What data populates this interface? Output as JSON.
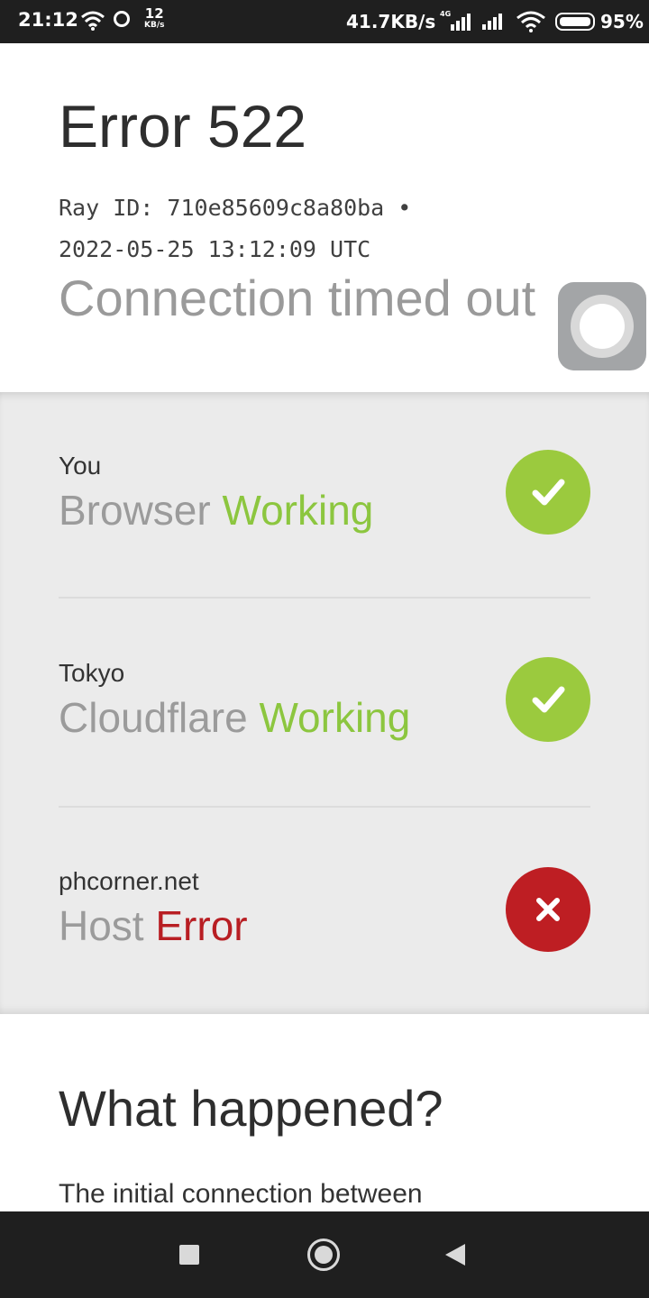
{
  "status_bar": {
    "time": "21:12",
    "net_rate_value": "12",
    "net_rate_unit": "KB/s",
    "speed": "41.7KB/s",
    "network_type": "4G",
    "battery": "95%"
  },
  "header": {
    "title": "Error 522",
    "ray_id": "Ray ID: 710e85609c8a80ba •",
    "timestamp": "2022-05-25 13:12:09 UTC",
    "subtitle": "Connection timed out"
  },
  "status_rows": [
    {
      "location": "You",
      "label": "Browser",
      "status": "Working",
      "state": "ok"
    },
    {
      "location": "Tokyo",
      "label": "Cloudflare",
      "status": "Working",
      "state": "ok"
    },
    {
      "location": "phcorner.net",
      "label": "Host",
      "status": "Error",
      "state": "error"
    }
  ],
  "what_happened": {
    "heading": "What happened?",
    "body": "The initial connection between"
  },
  "colors": {
    "ok": "#8cc63f",
    "error": "#b81e23",
    "status_bg": "#ebebeb"
  }
}
